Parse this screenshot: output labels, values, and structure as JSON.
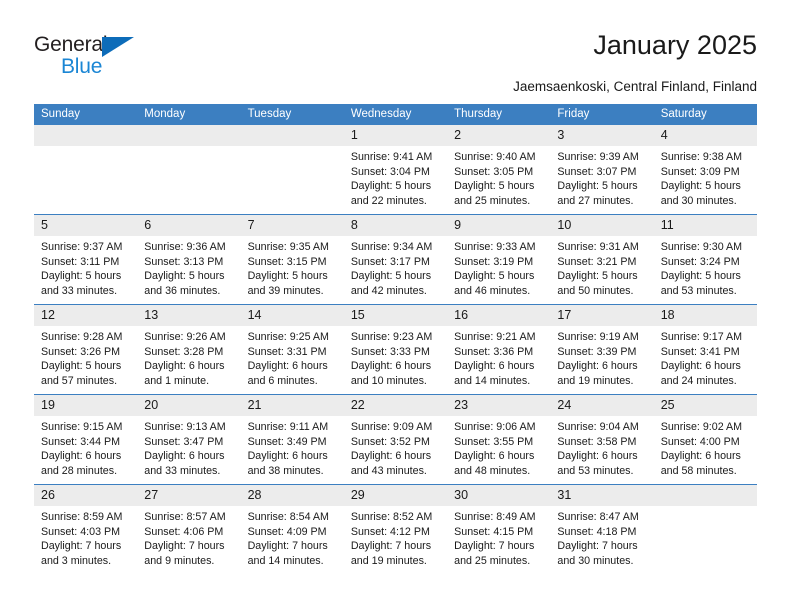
{
  "brand": {
    "name_part1": "General",
    "name_part2": "Blue",
    "triangle_color": "#0d6cb9",
    "blue_color": "#1b86d4"
  },
  "header": {
    "title": "January 2025",
    "subtitle": "Jaemsaenkoski, Central Finland, Finland"
  },
  "theme": {
    "header_blue": "#3c7fc1",
    "daynum_band": "#ececec",
    "text": "#1a1a1a"
  },
  "weekdays": [
    "Sunday",
    "Monday",
    "Tuesday",
    "Wednesday",
    "Thursday",
    "Friday",
    "Saturday"
  ],
  "calendar": {
    "month": "January",
    "year": "2025",
    "weeks": [
      [
        {
          "day": "",
          "sunrise": "",
          "sunset": "",
          "daylight_l1": "",
          "daylight_l2": ""
        },
        {
          "day": "",
          "sunrise": "",
          "sunset": "",
          "daylight_l1": "",
          "daylight_l2": ""
        },
        {
          "day": "",
          "sunrise": "",
          "sunset": "",
          "daylight_l1": "",
          "daylight_l2": ""
        },
        {
          "day": "1",
          "sunrise": "Sunrise: 9:41 AM",
          "sunset": "Sunset: 3:04 PM",
          "daylight_l1": "Daylight: 5 hours",
          "daylight_l2": "and 22 minutes."
        },
        {
          "day": "2",
          "sunrise": "Sunrise: 9:40 AM",
          "sunset": "Sunset: 3:05 PM",
          "daylight_l1": "Daylight: 5 hours",
          "daylight_l2": "and 25 minutes."
        },
        {
          "day": "3",
          "sunrise": "Sunrise: 9:39 AM",
          "sunset": "Sunset: 3:07 PM",
          "daylight_l1": "Daylight: 5 hours",
          "daylight_l2": "and 27 minutes."
        },
        {
          "day": "4",
          "sunrise": "Sunrise: 9:38 AM",
          "sunset": "Sunset: 3:09 PM",
          "daylight_l1": "Daylight: 5 hours",
          "daylight_l2": "and 30 minutes."
        }
      ],
      [
        {
          "day": "5",
          "sunrise": "Sunrise: 9:37 AM",
          "sunset": "Sunset: 3:11 PM",
          "daylight_l1": "Daylight: 5 hours",
          "daylight_l2": "and 33 minutes."
        },
        {
          "day": "6",
          "sunrise": "Sunrise: 9:36 AM",
          "sunset": "Sunset: 3:13 PM",
          "daylight_l1": "Daylight: 5 hours",
          "daylight_l2": "and 36 minutes."
        },
        {
          "day": "7",
          "sunrise": "Sunrise: 9:35 AM",
          "sunset": "Sunset: 3:15 PM",
          "daylight_l1": "Daylight: 5 hours",
          "daylight_l2": "and 39 minutes."
        },
        {
          "day": "8",
          "sunrise": "Sunrise: 9:34 AM",
          "sunset": "Sunset: 3:17 PM",
          "daylight_l1": "Daylight: 5 hours",
          "daylight_l2": "and 42 minutes."
        },
        {
          "day": "9",
          "sunrise": "Sunrise: 9:33 AM",
          "sunset": "Sunset: 3:19 PM",
          "daylight_l1": "Daylight: 5 hours",
          "daylight_l2": "and 46 minutes."
        },
        {
          "day": "10",
          "sunrise": "Sunrise: 9:31 AM",
          "sunset": "Sunset: 3:21 PM",
          "daylight_l1": "Daylight: 5 hours",
          "daylight_l2": "and 50 minutes."
        },
        {
          "day": "11",
          "sunrise": "Sunrise: 9:30 AM",
          "sunset": "Sunset: 3:24 PM",
          "daylight_l1": "Daylight: 5 hours",
          "daylight_l2": "and 53 minutes."
        }
      ],
      [
        {
          "day": "12",
          "sunrise": "Sunrise: 9:28 AM",
          "sunset": "Sunset: 3:26 PM",
          "daylight_l1": "Daylight: 5 hours",
          "daylight_l2": "and 57 minutes."
        },
        {
          "day": "13",
          "sunrise": "Sunrise: 9:26 AM",
          "sunset": "Sunset: 3:28 PM",
          "daylight_l1": "Daylight: 6 hours",
          "daylight_l2": "and 1 minute."
        },
        {
          "day": "14",
          "sunrise": "Sunrise: 9:25 AM",
          "sunset": "Sunset: 3:31 PM",
          "daylight_l1": "Daylight: 6 hours",
          "daylight_l2": "and 6 minutes."
        },
        {
          "day": "15",
          "sunrise": "Sunrise: 9:23 AM",
          "sunset": "Sunset: 3:33 PM",
          "daylight_l1": "Daylight: 6 hours",
          "daylight_l2": "and 10 minutes."
        },
        {
          "day": "16",
          "sunrise": "Sunrise: 9:21 AM",
          "sunset": "Sunset: 3:36 PM",
          "daylight_l1": "Daylight: 6 hours",
          "daylight_l2": "and 14 minutes."
        },
        {
          "day": "17",
          "sunrise": "Sunrise: 9:19 AM",
          "sunset": "Sunset: 3:39 PM",
          "daylight_l1": "Daylight: 6 hours",
          "daylight_l2": "and 19 minutes."
        },
        {
          "day": "18",
          "sunrise": "Sunrise: 9:17 AM",
          "sunset": "Sunset: 3:41 PM",
          "daylight_l1": "Daylight: 6 hours",
          "daylight_l2": "and 24 minutes."
        }
      ],
      [
        {
          "day": "19",
          "sunrise": "Sunrise: 9:15 AM",
          "sunset": "Sunset: 3:44 PM",
          "daylight_l1": "Daylight: 6 hours",
          "daylight_l2": "and 28 minutes."
        },
        {
          "day": "20",
          "sunrise": "Sunrise: 9:13 AM",
          "sunset": "Sunset: 3:47 PM",
          "daylight_l1": "Daylight: 6 hours",
          "daylight_l2": "and 33 minutes."
        },
        {
          "day": "21",
          "sunrise": "Sunrise: 9:11 AM",
          "sunset": "Sunset: 3:49 PM",
          "daylight_l1": "Daylight: 6 hours",
          "daylight_l2": "and 38 minutes."
        },
        {
          "day": "22",
          "sunrise": "Sunrise: 9:09 AM",
          "sunset": "Sunset: 3:52 PM",
          "daylight_l1": "Daylight: 6 hours",
          "daylight_l2": "and 43 minutes."
        },
        {
          "day": "23",
          "sunrise": "Sunrise: 9:06 AM",
          "sunset": "Sunset: 3:55 PM",
          "daylight_l1": "Daylight: 6 hours",
          "daylight_l2": "and 48 minutes."
        },
        {
          "day": "24",
          "sunrise": "Sunrise: 9:04 AM",
          "sunset": "Sunset: 3:58 PM",
          "daylight_l1": "Daylight: 6 hours",
          "daylight_l2": "and 53 minutes."
        },
        {
          "day": "25",
          "sunrise": "Sunrise: 9:02 AM",
          "sunset": "Sunset: 4:00 PM",
          "daylight_l1": "Daylight: 6 hours",
          "daylight_l2": "and 58 minutes."
        }
      ],
      [
        {
          "day": "26",
          "sunrise": "Sunrise: 8:59 AM",
          "sunset": "Sunset: 4:03 PM",
          "daylight_l1": "Daylight: 7 hours",
          "daylight_l2": "and 3 minutes."
        },
        {
          "day": "27",
          "sunrise": "Sunrise: 8:57 AM",
          "sunset": "Sunset: 4:06 PM",
          "daylight_l1": "Daylight: 7 hours",
          "daylight_l2": "and 9 minutes."
        },
        {
          "day": "28",
          "sunrise": "Sunrise: 8:54 AM",
          "sunset": "Sunset: 4:09 PM",
          "daylight_l1": "Daylight: 7 hours",
          "daylight_l2": "and 14 minutes."
        },
        {
          "day": "29",
          "sunrise": "Sunrise: 8:52 AM",
          "sunset": "Sunset: 4:12 PM",
          "daylight_l1": "Daylight: 7 hours",
          "daylight_l2": "and 19 minutes."
        },
        {
          "day": "30",
          "sunrise": "Sunrise: 8:49 AM",
          "sunset": "Sunset: 4:15 PM",
          "daylight_l1": "Daylight: 7 hours",
          "daylight_l2": "and 25 minutes."
        },
        {
          "day": "31",
          "sunrise": "Sunrise: 8:47 AM",
          "sunset": "Sunset: 4:18 PM",
          "daylight_l1": "Daylight: 7 hours",
          "daylight_l2": "and 30 minutes."
        },
        {
          "day": "",
          "sunrise": "",
          "sunset": "",
          "daylight_l1": "",
          "daylight_l2": ""
        }
      ]
    ]
  }
}
